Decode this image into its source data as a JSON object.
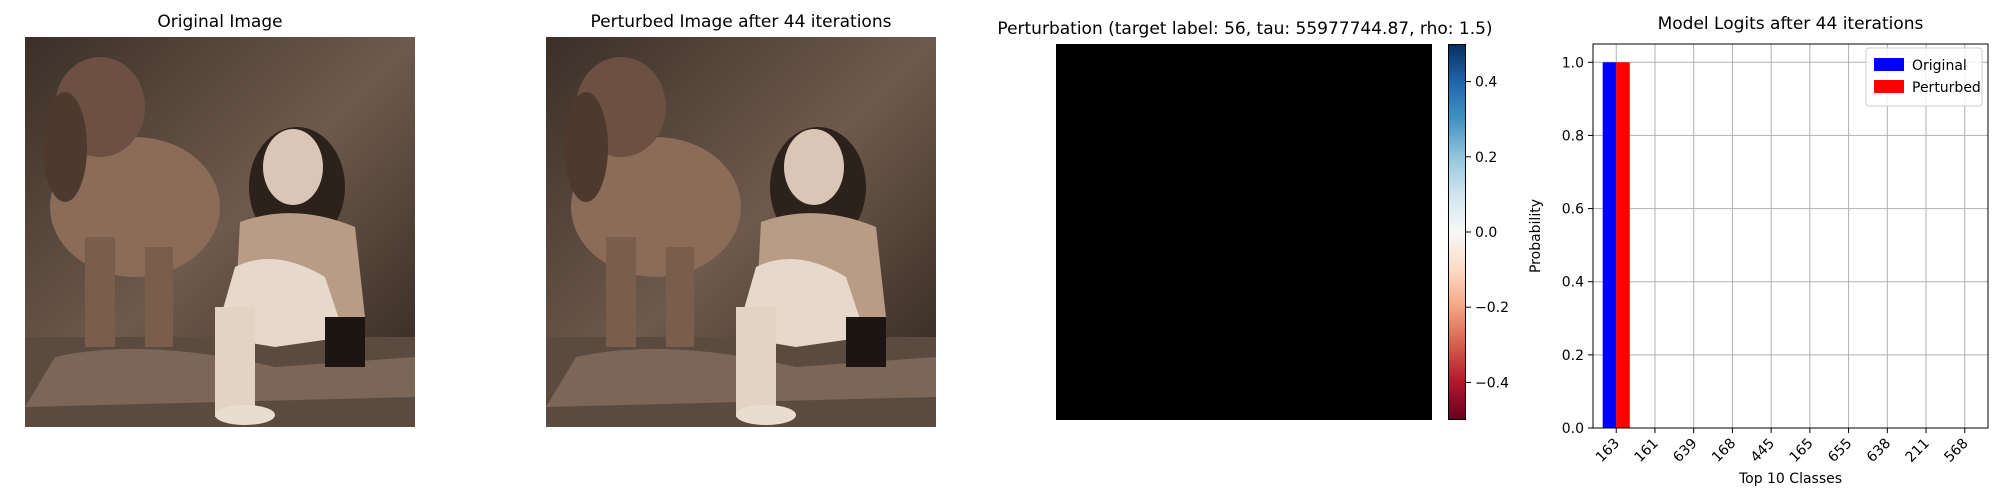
{
  "panels": {
    "original_title": "Original Image",
    "perturbed_title": "Perturbed Image after 44 iterations",
    "perturbation_title": "Perturbation (target label: 56, tau: 55977744.87, rho: 1.5)",
    "logits_title": "Model Logits after 44 iterations"
  },
  "colors": {
    "original": "#0000ff",
    "perturbed": "#ff0000",
    "perturbation_field": "#000000",
    "grid": "#b0b0b0"
  },
  "colorbar": {
    "range": [
      -0.5,
      0.5
    ],
    "ticks": [
      {
        "value": 0.4,
        "label": "0.4"
      },
      {
        "value": 0.2,
        "label": "0.2"
      },
      {
        "value": 0.0,
        "label": "0.0"
      },
      {
        "value": -0.2,
        "label": "−0.2"
      },
      {
        "value": -0.4,
        "label": "−0.4"
      }
    ]
  },
  "chart_data": {
    "type": "bar",
    "title": "Model Logits after 44 iterations",
    "xlabel": "Top 10 Classes",
    "ylabel": "Probability",
    "categories": [
      "163",
      "161",
      "639",
      "168",
      "445",
      "165",
      "655",
      "638",
      "211",
      "568"
    ],
    "series": [
      {
        "name": "Original",
        "values": [
          1.0,
          0,
          0,
          0,
          0,
          0,
          0,
          0,
          0,
          0
        ]
      },
      {
        "name": "Perturbed",
        "values": [
          1.0,
          0,
          0,
          0,
          0,
          0,
          0,
          0,
          0,
          0
        ]
      }
    ],
    "ylim": [
      0,
      1.05
    ],
    "yticks": [
      "0.0",
      "0.2",
      "0.4",
      "0.6",
      "0.8",
      "1.0"
    ],
    "grid": true,
    "legend": "top-right"
  }
}
